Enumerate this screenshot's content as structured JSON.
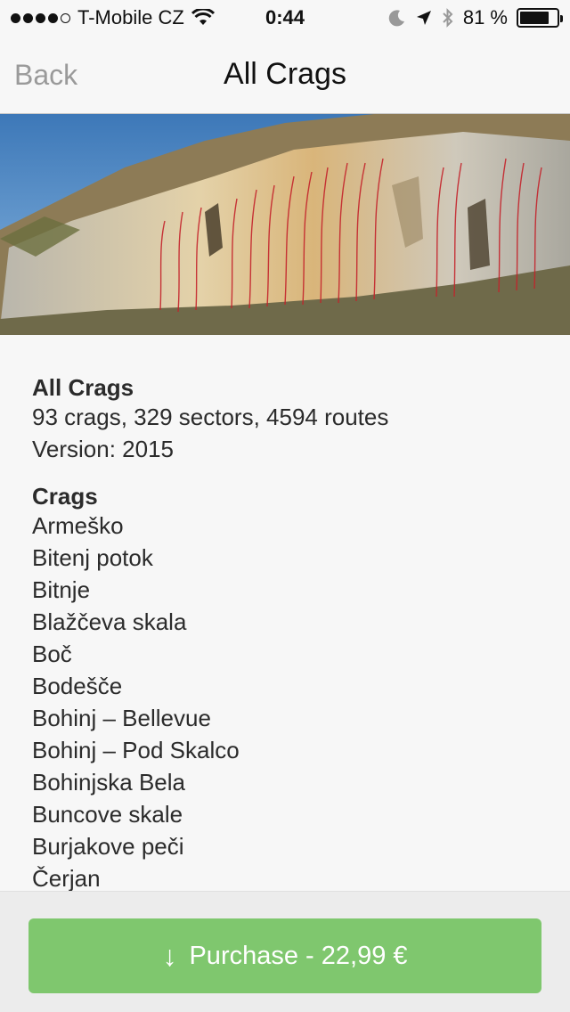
{
  "status_bar": {
    "carrier": "T-Mobile CZ",
    "time": "0:44",
    "battery": "81 %",
    "battery_level": 0.81
  },
  "nav": {
    "back_label": "Back",
    "title": "All Crags"
  },
  "info": {
    "title": "All Crags",
    "stats": "93 crags, 329 sectors, 4594 routes",
    "version": "Version: 2015"
  },
  "crags": {
    "title": "Crags",
    "items": [
      "Armeško",
      "Bitenj potok",
      "Bitnje",
      "Blažčeva skala",
      "Boč",
      "Bodešče",
      "Bohinj – Bellevue",
      "Bohinj – Pod Skalco",
      "Bohinjska Bela",
      "Buncove skale",
      "Burjakove peči",
      "Čerjan"
    ]
  },
  "purchase": {
    "label": "Purchase - 22,99 €",
    "icon": "↓"
  },
  "colors": {
    "accent": "#7fc76e",
    "back": "#9a9a9a"
  }
}
